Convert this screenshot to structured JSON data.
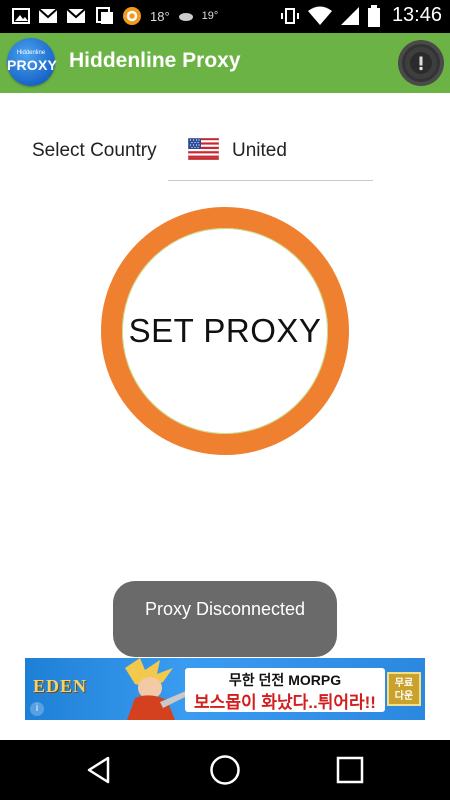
{
  "status_bar": {
    "temp1": "18°",
    "temp2": "19°",
    "time": "13:46",
    "icons": [
      "image-icon",
      "gmail-icon",
      "gmail-icon",
      "sync-icon",
      "app-icon",
      "weather-icon",
      "vibrate-icon",
      "wifi-icon",
      "signal-icon",
      "battery-icon"
    ]
  },
  "app_bar": {
    "logo_small": "Hiddenline",
    "logo_big": "PROXY",
    "title": "Hiddenline Proxy",
    "alert_icon": "alert-icon"
  },
  "country": {
    "label": "Select Country",
    "selected": "United",
    "flag_icon": "us-flag-icon"
  },
  "proxy_button": {
    "label": "SET PROXY",
    "ring_color": "#ef8030"
  },
  "toast": {
    "message": "Proxy Disconnected"
  },
  "ad": {
    "logo": "EDEN",
    "line1": "무한 던전 MORPG",
    "line2": "보스몹이 화났다..튀어라!!",
    "button": "무료 다운"
  },
  "colors": {
    "app_bar": "#6cb345",
    "accent": "#ef8030",
    "toast_bg": "#6a6a6a"
  },
  "nav": {
    "back_icon": "back-icon",
    "home_icon": "home-icon",
    "recents_icon": "recents-icon"
  }
}
